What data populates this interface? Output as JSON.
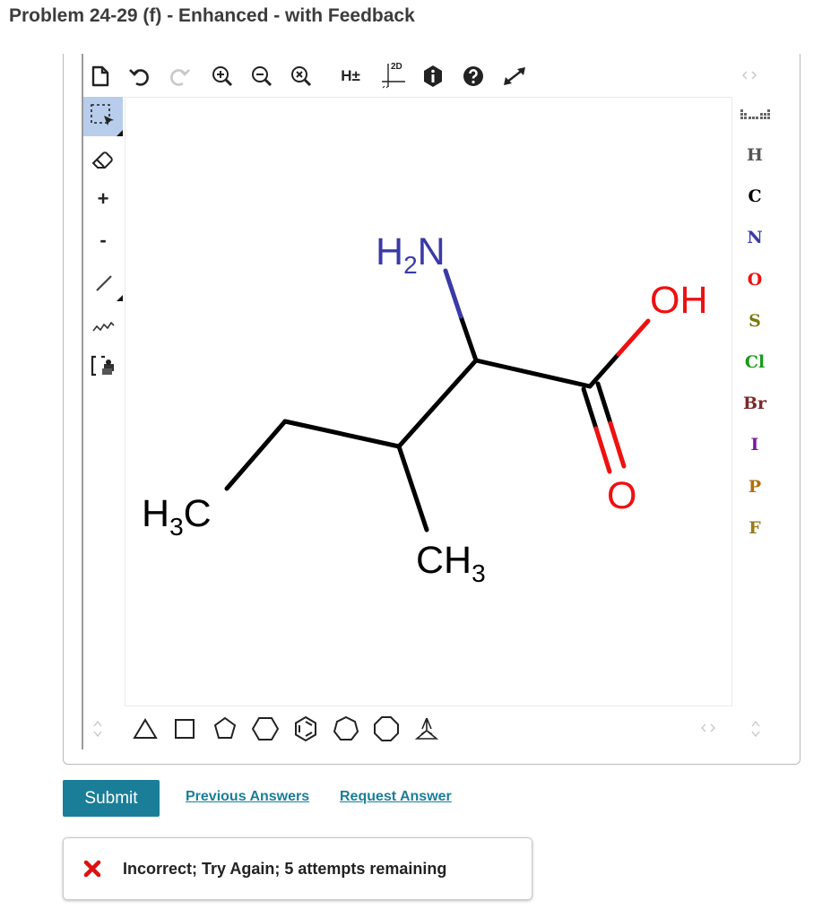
{
  "page": {
    "title": "Problem 24-29 (f) - Enhanced - with Feedback"
  },
  "top_toolbar": {
    "tools": [
      "new-document-icon",
      "undo-icon",
      "redo-icon",
      "zoom-in-icon",
      "zoom-out-icon",
      "zoom-reset-icon",
      "hydrogen-toggle",
      "clean-2d-icon",
      "info-icon",
      "help-icon",
      "fullscreen-icon"
    ],
    "hydrogen_label": "H±",
    "clean_label": "2D"
  },
  "left_toolbar": {
    "charge_plus": "+",
    "charge_minus": "-"
  },
  "elements": [
    {
      "symbol": "H",
      "color": "#555555"
    },
    {
      "symbol": "C",
      "color": "#000000"
    },
    {
      "symbol": "N",
      "color": "#3a3aa8"
    },
    {
      "symbol": "O",
      "color": "#ee1111"
    },
    {
      "symbol": "S",
      "color": "#7a7a0c"
    },
    {
      "symbol": "Cl",
      "color": "#1a9a1a"
    },
    {
      "symbol": "Br",
      "color": "#7a2a2a"
    },
    {
      "symbol": "I",
      "color": "#7a1aa0"
    },
    {
      "symbol": "P",
      "color": "#b0700c"
    },
    {
      "symbol": "F",
      "color": "#9a7a1a"
    }
  ],
  "molecule": {
    "labels": {
      "amine": {
        "main": "H",
        "sub": "2",
        "tail": "N"
      },
      "hydroxyl": "OH",
      "carbonyl_o": "O",
      "methyl_left": {
        "main": "H",
        "sub": "3",
        "tail": "C"
      },
      "methyl_bottom": {
        "main": "CH",
        "sub": "3"
      }
    },
    "colors": {
      "bond": "#000000",
      "nitrogen": "#3a3aa8",
      "oxygen": "#ee1111"
    }
  },
  "actions": {
    "submit": "Submit",
    "previous_answers": "Previous Answers",
    "request_answer": "Request Answer"
  },
  "feedback": {
    "status": "Incorrect; Try Again; 5 attempts remaining",
    "icon": "x-mark-icon",
    "color": "#dd1111"
  }
}
